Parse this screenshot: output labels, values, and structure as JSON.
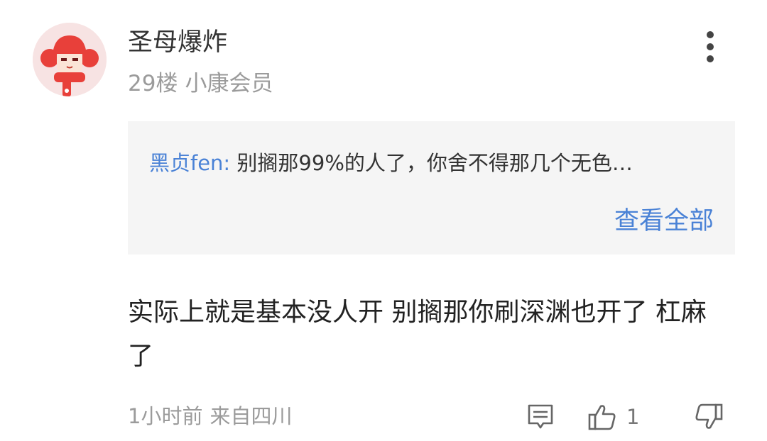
{
  "user": {
    "name": "圣母爆炸",
    "floor": "29楼",
    "badge": "小康会员"
  },
  "reply": {
    "author": "黑贞fen:",
    "text": "别搁那99%的人了，你舍不得那几个无色…",
    "view_all_label": "查看全部"
  },
  "content": "实际上就是基本没人开  别搁那你刷深渊也开了  杠麻了",
  "footer": {
    "time": "1小时前",
    "location": "来自四川",
    "like_count": "1"
  },
  "colors": {
    "accent": "#4a82d6",
    "muted": "#9b9b9b",
    "reply_bg": "#f5f5f5",
    "avatar_red": "#e8403a"
  },
  "icons": [
    "avatar-image",
    "more-vertical-icon",
    "comment-icon",
    "thumbs-up-icon",
    "thumbs-down-icon"
  ]
}
